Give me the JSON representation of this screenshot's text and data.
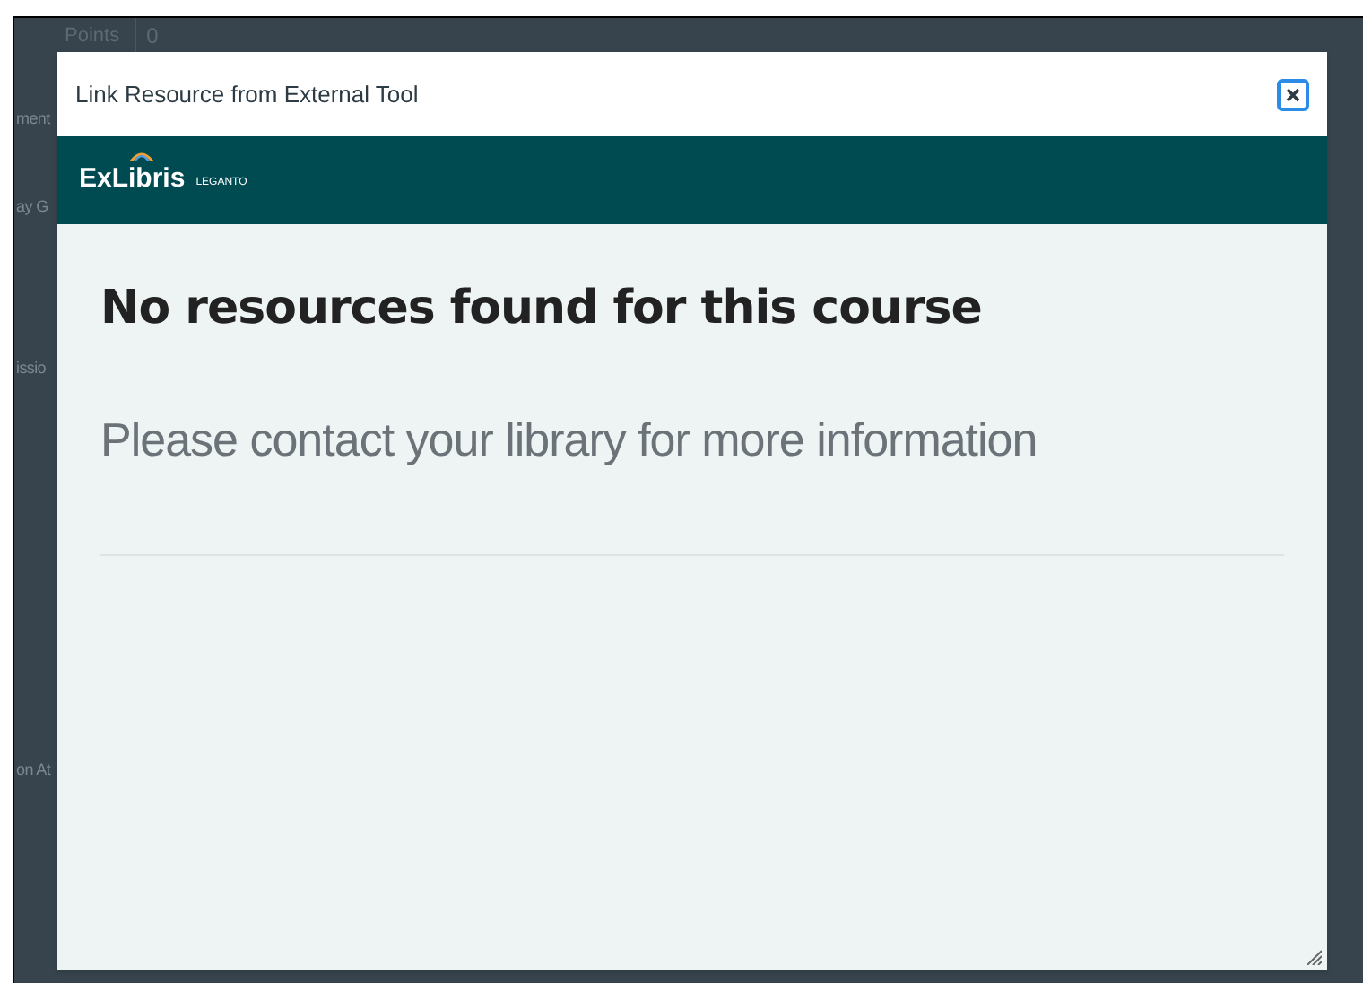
{
  "background": {
    "points_label": "Points",
    "points_value": "0",
    "fragments": [
      "ment",
      "ay G",
      "issio",
      "on At"
    ]
  },
  "dialog": {
    "title": "Link Resource from External Tool",
    "brand": {
      "name": "ExLibris",
      "product": "LEGANTO"
    },
    "heading": "No resources found for this course",
    "message": "Please contact your library for more information"
  }
}
